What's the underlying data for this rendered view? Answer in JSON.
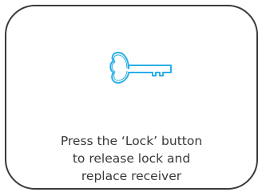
{
  "dialog": {
    "icon": "key-icon",
    "accent_color": "#29aee6",
    "message_lines": [
      "Press the ‘Lock’ button",
      "to release lock and",
      "replace receiver"
    ]
  }
}
